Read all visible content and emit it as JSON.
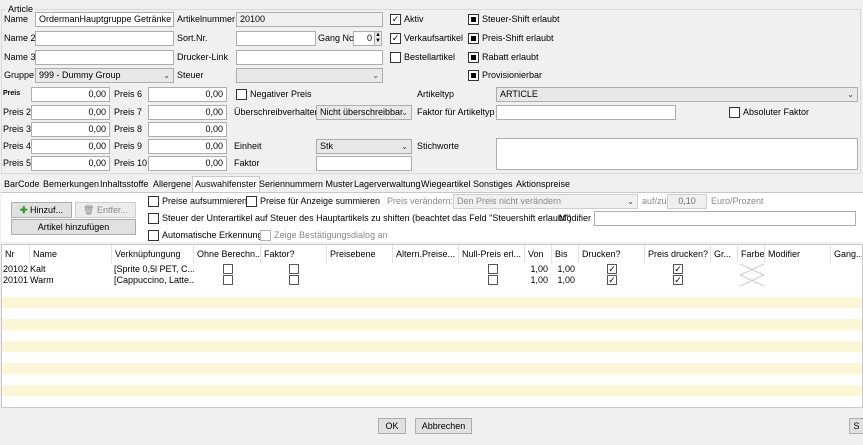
{
  "group_title": "Article",
  "labels": {
    "name": "Name",
    "name2": "Name 2",
    "name3": "Name 3",
    "gruppe": "Gruppe",
    "artikelnummer": "Artikelnummer",
    "sortnr": "Sort.Nr.",
    "gangno": "Gang No",
    "druckerlink": "Drucker-Link",
    "steuer": "Steuer",
    "preis": "Preis",
    "preis2": "Preis 2",
    "preis3": "Preis 3",
    "preis4": "Preis 4",
    "preis5": "Preis 5",
    "preis6": "Preis 6",
    "preis7": "Preis 7",
    "preis8": "Preis 8",
    "preis9": "Preis 9",
    "preis10": "Preis 10",
    "ueberschreibverhalten": "Überschreibverhalten",
    "einheit": "Einheit",
    "faktor": "Faktor",
    "artikeltyp": "Artikeltyp",
    "faktor_fuer_artikeltyp": "Faktor für Artikeltyp",
    "stichworte": "Stichworte"
  },
  "fields": {
    "name": "OrdermanHauptgruppe Getränke",
    "name2": "",
    "name3": "",
    "gruppe": "999 - Dummy Group",
    "artikelnummer": "20100",
    "sortnr": "",
    "gangno": "0",
    "druckerlink": "",
    "steuer": "",
    "preis": "0,00",
    "preis2": "0,00",
    "preis3": "0,00",
    "preis4": "0,00",
    "preis5": "0,00",
    "preis6": "0,00",
    "preis7": "0,00",
    "preis8": "0,00",
    "preis9": "0,00",
    "preis10": "0,00",
    "ueberschreibverhalten": "Nicht überschreibbar",
    "einheit": "Stk",
    "faktor": "",
    "artikeltyp": "ARTICLE",
    "faktor_fuer_artikeltyp": "",
    "stichworte": ""
  },
  "checkboxes": {
    "aktiv": "Aktiv",
    "verkaufsartikel": "Verkaufsartikel",
    "bestellartikel": "Bestellartikel",
    "steuer_shift": "Steuer-Shift erlaubt",
    "preis_shift": "Preis-Shift erlaubt",
    "rabatt": "Rabatt erlaubt",
    "provisionierbar": "Provisionierbar",
    "negativer_preis": "Negativer Preis",
    "absoluter_faktor": "Absoluter Faktor"
  },
  "tabs": [
    "BarCode",
    "Bemerkungen",
    "Inhaltsstoffe",
    "Allergene",
    "Auswahlfenster",
    "Seriennummern Muster",
    "Lagerverwaltung",
    "Wiegeartikel",
    "Sonstiges",
    "Aktionspreise"
  ],
  "panel": {
    "hinzufuegen": "Hinzuf...",
    "entfernen": "Entfer...",
    "artikel_hinzufuegen": "Artikel hinzufügen",
    "preise_aufsummieren": "Preise aufsummieren",
    "preise_fuer_anzeige": "Preise für Anzeige summieren",
    "preis_veraendern_label": "Preis verändern:",
    "preis_veraendern_value": "Den Preis nicht verändern",
    "aufzu_label": "auf/zu",
    "aufzu_value": "0,10",
    "euro_prozent": "Euro/Prozent",
    "steuer_unterartikel": "Steuer der Unterartikel auf Steuer des Hauptartikels zu shiften (beachtet das Feld \"Steuershift erlaubt\")",
    "modifier_label": "Modifier",
    "modifier_value": "",
    "automatische_erkennung": "Automatische Erkennung",
    "zeige_bestaetigung": "Zeige Bestätigungsdialog an"
  },
  "grid": {
    "columns": [
      "Nr",
      "Name",
      "Verknüpfungung",
      "Ohne Berechn...",
      "Faktor?",
      "Preisebene",
      "Altern.Preise...",
      "Null-Preis erl...",
      "Von",
      "Bis",
      "Drucken?",
      "Preis drucken?",
      "Gr...",
      "Farbe",
      "Modifier",
      "Gang..."
    ],
    "rows": [
      {
        "nr": "20102",
        "name": "Kalt",
        "verkn": "[Sprite 0,5l PET, C...",
        "von": "1,00",
        "bis": "1,00"
      },
      {
        "nr": "20101",
        "name": "Warm",
        "verkn": "[Cappuccino, Latte...",
        "von": "1,00",
        "bis": "1,00"
      }
    ]
  },
  "footer": {
    "ok": "OK",
    "abbrechen": "Abbrechen",
    "extra": "S"
  }
}
